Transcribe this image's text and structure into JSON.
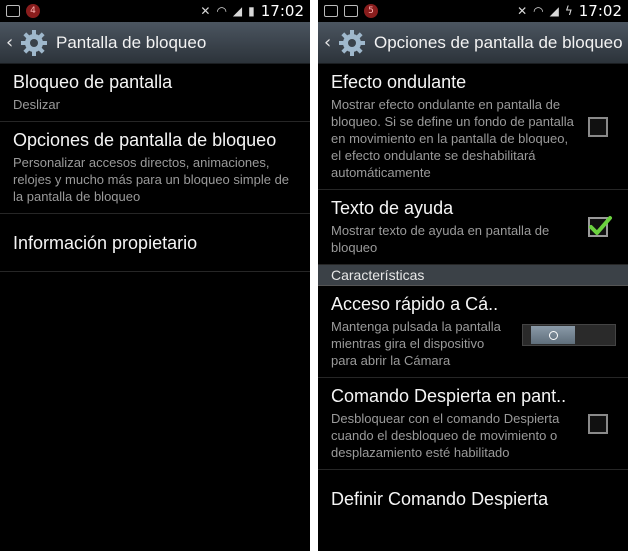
{
  "status_bar": {
    "notification_count": "4",
    "notification_count_right": "5",
    "time": "17:02"
  },
  "left_screen": {
    "title": "Pantalla de bloqueo",
    "items": [
      {
        "title": "Bloqueo de pantalla",
        "subtitle": "Deslizar"
      },
      {
        "title": "Opciones de pantalla de bloqueo",
        "subtitle": "Personalizar accesos directos, animaciones, relojes y mucho más para un bloqueo simple de la pantalla de bloqueo"
      },
      {
        "title": "Información propietario",
        "subtitle": ""
      }
    ]
  },
  "right_screen": {
    "title": "Opciones de pantalla de bloqueo",
    "items": [
      {
        "title": "Efecto ondulante",
        "subtitle": "Mostrar efecto ondulante en pantalla de bloqueo. Si se define un fondo de pantalla en movimiento en la pantalla de bloqueo, el efecto ondulante se deshabilitará automáticamente",
        "checked": false
      },
      {
        "title": "Texto de ayuda",
        "subtitle": "Mostrar texto de ayuda en pantalla de bloqueo",
        "checked": true
      }
    ],
    "section_header": "Características",
    "features": [
      {
        "title": "Acceso rápido a Cá..",
        "subtitle": "Mantenga pulsada la pantalla mientras gira el dispositivo para abrir la Cámara",
        "switch_on": false
      },
      {
        "title": "Comando Despierta en pant..",
        "subtitle": "Desbloquear con el comando Despierta cuando el desbloqueo de movimiento o desplazamiento esté habilitado",
        "checked": false
      },
      {
        "title": "Definir Comando Despierta"
      }
    ]
  },
  "colors": {
    "action_bar": "#3a424a",
    "check_accent": "#6bd13f",
    "section_header": "#3b4147"
  }
}
